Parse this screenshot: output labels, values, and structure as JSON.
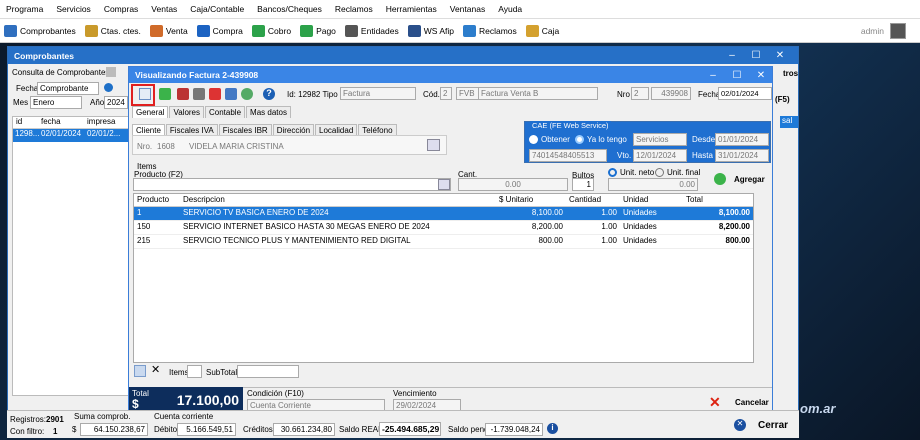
{
  "menubar": [
    "Programa",
    "Servicios",
    "Compras",
    "Ventas",
    "Caja/Contable",
    "Bancos/Cheques",
    "Reclamos",
    "Herramientas",
    "Ventanas",
    "Ayuda"
  ],
  "toolbar": [
    {
      "label": "Comprobantes",
      "icon": "documents-icon"
    },
    {
      "label": "Ctas. ctes.",
      "icon": "accounts-icon"
    },
    {
      "label": "Venta",
      "icon": "sale-icon"
    },
    {
      "label": "Compra",
      "icon": "cart-icon"
    },
    {
      "label": "Cobro",
      "icon": "dollar-in-icon"
    },
    {
      "label": "Pago",
      "icon": "dollar-out-icon"
    },
    {
      "label": "Entidades",
      "icon": "entities-icon"
    },
    {
      "label": "WS Afip",
      "icon": "webservice-icon"
    },
    {
      "label": "Reclamos",
      "icon": "claims-icon"
    },
    {
      "label": "Caja",
      "icon": "cashbox-icon"
    }
  ],
  "user": "admin",
  "watermark": "om.ar",
  "comp": {
    "title": "Comprobantes",
    "consulta": "Consulta de Comprobantes",
    "fecha_label": "Fecha",
    "fecha_sel": "Comprobante",
    "mes_label": "Mes",
    "mes_val": "Enero",
    "anio_label": "Año",
    "anio_val": "2024",
    "right_cut": "tros",
    "grid_headers": [
      "id",
      "fecha",
      "impresa"
    ],
    "grid_row": [
      "1298...",
      "02/01/2024",
      "02/01/2..."
    ],
    "right_col": "sal"
  },
  "fact": {
    "title": "Visualizando Factura 2-439908",
    "id_label": "Id: 12982 Tipo",
    "tipo": "Factura",
    "cod_label": "Cód.",
    "cod_num": "2",
    "cod_code": "FVB",
    "cod_desc": "Factura Venta B",
    "nro_label": "Nro",
    "nro_pv": "2",
    "nro": "439908",
    "fecha_label": "Fecha",
    "fecha": "02/01/2024",
    "f5": "(F5)",
    "tabs": [
      "General",
      "Valores",
      "Contable",
      "Mas datos"
    ],
    "subtabs": [
      "Cliente",
      "Fiscales IVA",
      "Fiscales IBR",
      "Dirección",
      "Localidad",
      "Teléfono"
    ],
    "cliente_label": "Nro.",
    "cliente_nro": "1608",
    "cliente_nombre": "VIDELA MARIA CRISTINA",
    "cae_title": "CAE (FE Web Service)",
    "cae_obtener": "Obtener",
    "cae_tengo": "Ya lo tengo",
    "cae_servicios": "Servicios",
    "cae_desde_l": "Desde",
    "cae_desde": "01/01/2024",
    "cae_num": "74014548405513",
    "cae_vto_l": "Vto.",
    "cae_vto": "12/01/2024",
    "cae_hasta_l": "Hasta",
    "cae_hasta": "31/01/2024",
    "items_label": "Items",
    "producto_label": "Producto (F2)",
    "cant_label": "Cant.",
    "cant_val": "0.00",
    "bultos_label": "Bultos",
    "bultos_val": "1",
    "unit_neto": "Unit. neto",
    "unit_final": "Unit. final",
    "unit_val": "0.00",
    "agregar": "Agregar",
    "headers": [
      "Producto",
      "Descripcion",
      "$ Unitario",
      "Cantidad",
      "Unidad",
      "Total"
    ],
    "rows": [
      [
        "1",
        "SERVICIO TV BASICA ENERO DE 2024",
        "8,100.00",
        "1.00",
        "Unidades",
        "8,100.00"
      ],
      [
        "150",
        "SERVICIO INTERNET BASICO HASTA 30 MEGAS ENERO DE 2024",
        "8,200.00",
        "1.00",
        "Unidades",
        "8,200.00"
      ],
      [
        "215",
        "SERVICIO TECNICO PLUS Y MANTENIMIENTO RED DIGITAL",
        "800.00",
        "1.00",
        "Unidades",
        "800.00"
      ]
    ],
    "items_count_l": "Items",
    "subtotal_l": "SubTotal",
    "total_label": "Total",
    "total_cur": "$",
    "total": "17.100,00",
    "cond_label": "Condición (F10)",
    "cond_val": "Cuenta Corriente",
    "venc_label": "Vencimiento",
    "venc_val": "29/02/2024",
    "cancelar": "Cancelar"
  },
  "status": {
    "registros_l": "Registros:",
    "registros": "2901",
    "confil_l": "Con filtro:",
    "confil": "1",
    "suma_l": "Suma comprob.",
    "suma_cur": "$",
    "suma": "64.150.238,67",
    "ctacte_l": "Cuenta corriente",
    "debitos_l": "Débitos",
    "debitos": "5.166.549,51",
    "creditos_l": "Créditos",
    "creditos": "30.661.234,80",
    "saldoreal_l": "Saldo REAL",
    "saldoreal": "-25.494.685,29",
    "saldopend_l": "Saldo pend",
    "saldopend": "-1.739.048,24",
    "cerrar": "Cerrar"
  }
}
